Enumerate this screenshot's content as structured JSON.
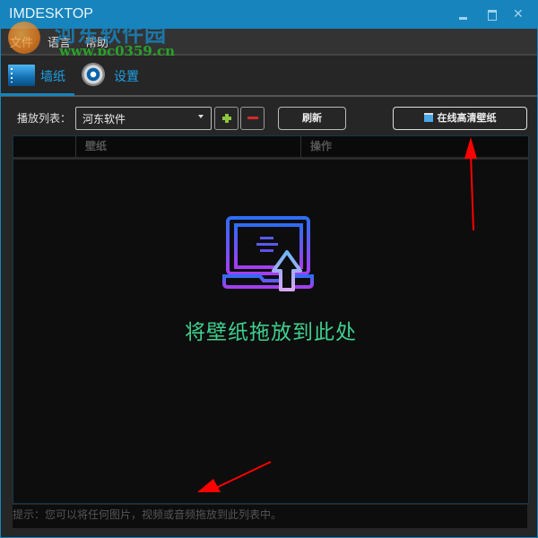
{
  "window": {
    "title": "IMDESKTOP",
    "controls": {
      "minimize": "minimize",
      "maximize": "maximize",
      "close": "✕"
    }
  },
  "watermark": {
    "text": "河东软件园",
    "url_text": "www.pc0359.cn"
  },
  "menu": {
    "items": [
      {
        "label": "文件"
      },
      {
        "label": "语言"
      },
      {
        "label": "帮助"
      }
    ]
  },
  "tabs": [
    {
      "label": "墙纸",
      "icon": "wallpaper-icon",
      "active": true
    },
    {
      "label": "设置",
      "icon": "gear-icon",
      "active": false
    }
  ],
  "toolbar": {
    "playlist_label": "播放列表：",
    "playlist_value": "河东软件",
    "add_icon": "plus-icon",
    "remove_icon": "minus-icon",
    "refresh_label": "刷新",
    "online_label": "在线高清壁纸",
    "online_icon": "clapperboard-icon"
  },
  "grid": {
    "columns": [
      {
        "label": ""
      },
      {
        "label": "壁纸"
      },
      {
        "label": "操作"
      }
    ],
    "rows": []
  },
  "drop_zone": {
    "text": "将壁纸拖放到此处",
    "icon": "laptop-upload-icon"
  },
  "hint": "提示：您可以将任何图片，视频或音频拖放到此列表中。",
  "colors": {
    "accent": "#1784bd",
    "drop_text": "#3ecf8e",
    "annotation_arrow": "#ff0000"
  }
}
